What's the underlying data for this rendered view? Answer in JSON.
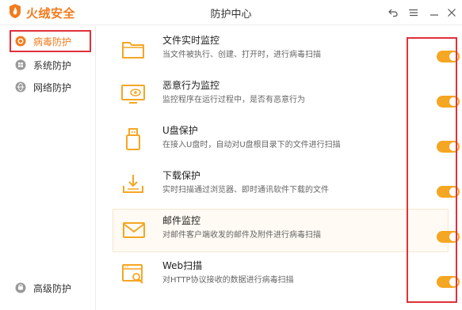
{
  "app": {
    "brand": "火绒安全",
    "window_title": "防护中心"
  },
  "sidebar": {
    "items": [
      {
        "label": "病毒防护",
        "icon": "shield-target-icon",
        "active": true
      },
      {
        "label": "系统防护",
        "icon": "windows-icon",
        "active": false
      },
      {
        "label": "网络防护",
        "icon": "globe-icon",
        "active": false
      }
    ],
    "bottom": {
      "label": "高级防护",
      "icon": "advanced-shield-icon"
    }
  },
  "features": [
    {
      "title": "文件实时监控",
      "desc": "当文件被执行、创建、打开时，进行病毒扫描",
      "icon": "folder-icon",
      "enabled": true
    },
    {
      "title": "恶意行为监控",
      "desc": "监控程序在运行过程中，是否有恶意行为",
      "icon": "monitor-eye-icon",
      "enabled": true
    },
    {
      "title": "U盘保护",
      "desc": "在接入U盘时，自动对U盘根目录下的文件进行扫描",
      "icon": "usb-drive-icon",
      "enabled": true
    },
    {
      "title": "下载保护",
      "desc": "实时扫描通过浏览器、即时通讯软件下载的文件",
      "icon": "download-tray-icon",
      "enabled": true
    },
    {
      "title": "邮件监控",
      "desc": "对邮件客户端收发的邮件及附件进行病毒扫描",
      "icon": "mail-icon",
      "enabled": true
    },
    {
      "title": "Web扫描",
      "desc": "对HTTP协议接收的数据进行病毒扫描",
      "icon": "web-scan-icon",
      "enabled": true
    }
  ],
  "colors": {
    "accent": "#f37b1d",
    "toggle_on": "#f5a623",
    "highlight_box": "#e0303a"
  }
}
